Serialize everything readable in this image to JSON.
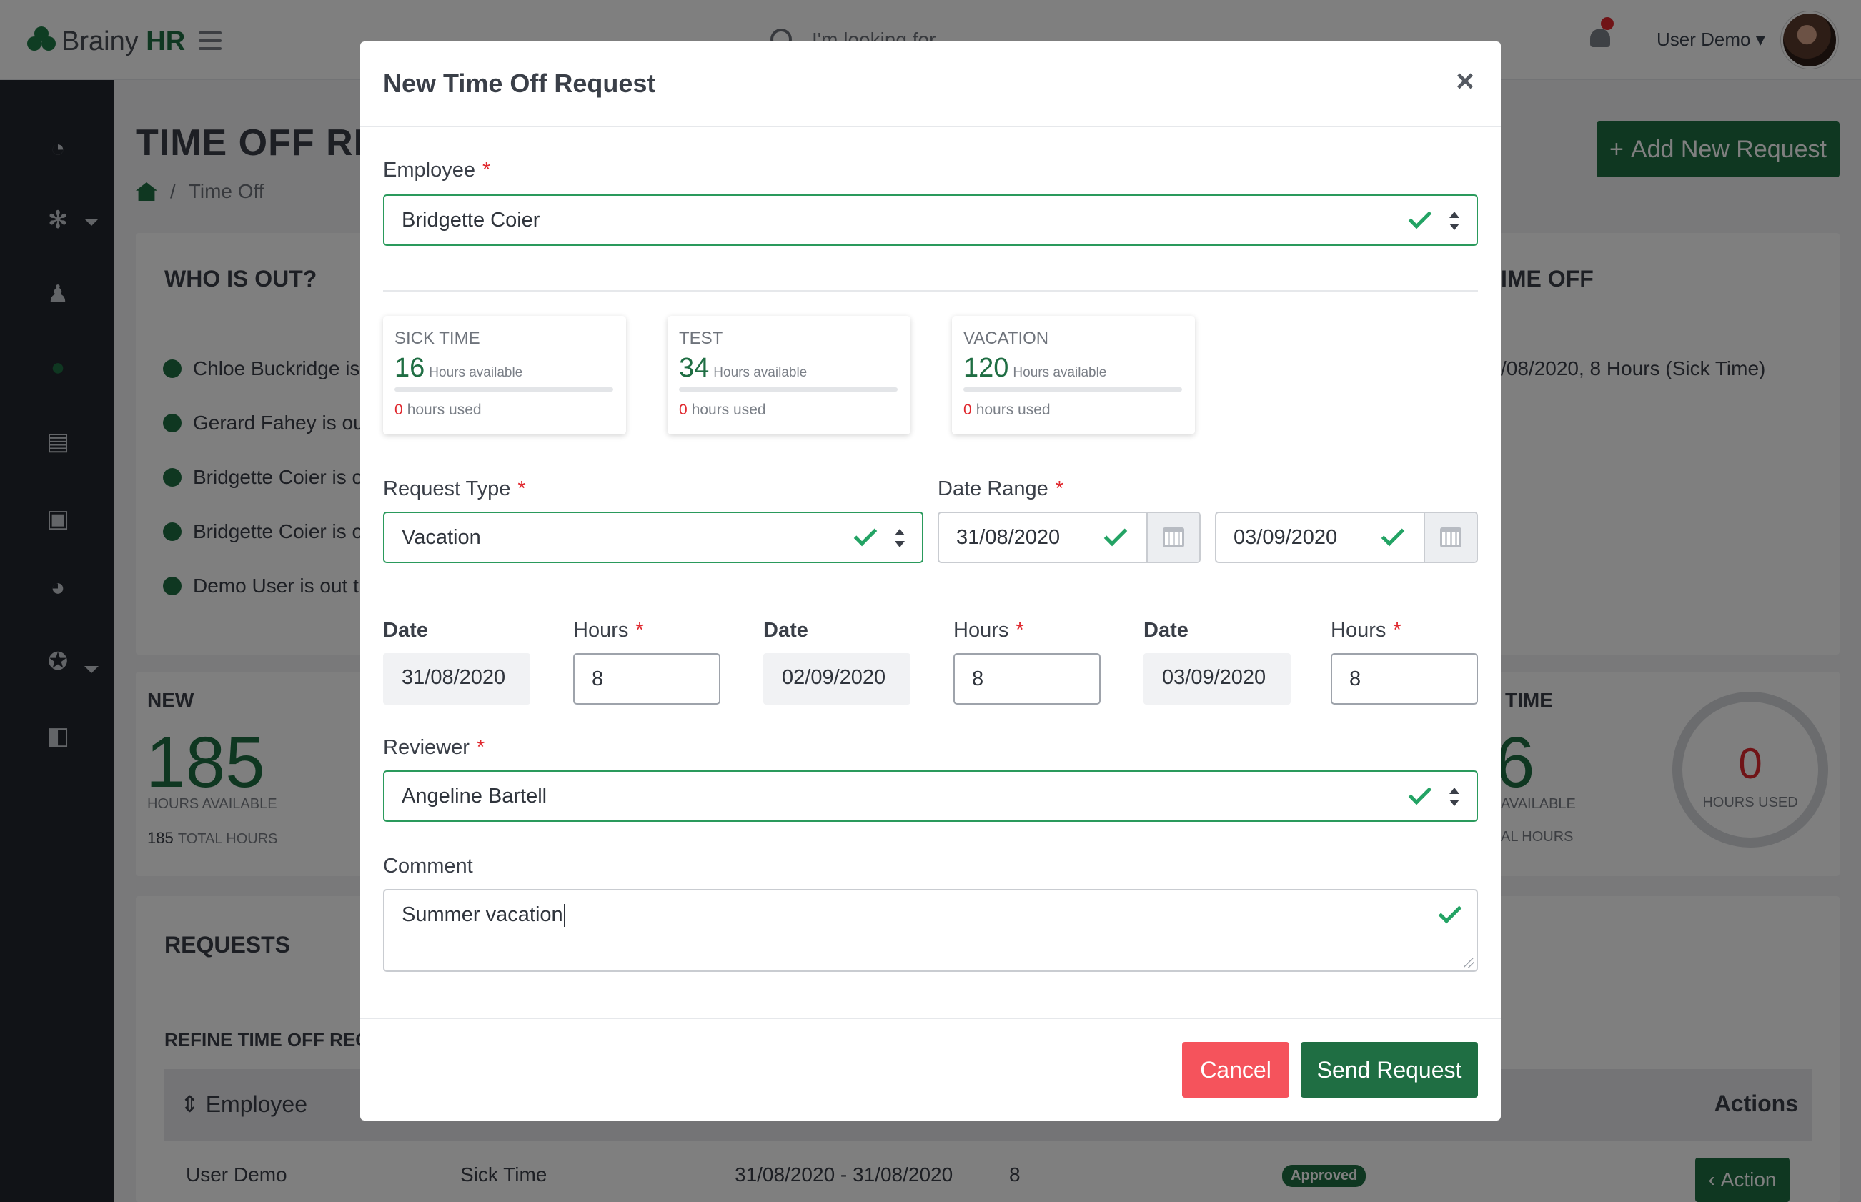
{
  "app": {
    "name_prefix": "Brainy",
    "name_suffix": "HR"
  },
  "topbar": {
    "search_placeholder": "I'm looking for...",
    "user_label": "User Demo",
    "user_caret": "▾"
  },
  "page": {
    "title": "TIME OFF REQUESTS",
    "breadcrumb_sep": "/",
    "breadcrumb_current": "Time Off",
    "add_button": "Add New Request",
    "add_icon": "+"
  },
  "who_is_out": {
    "title": "WHO IS OUT?",
    "items": [
      "Chloe Buckridge is",
      "Gerard Fahey is ou",
      "Bridgette Coier is o",
      "Bridgette Coier is o",
      "Demo User is out t"
    ]
  },
  "upcoming": {
    "title_fragment": "IME OFF",
    "item_fragment": "/08/2020, 8 Hours (Sick Time)"
  },
  "new_card": {
    "title": "NEW",
    "value": "185",
    "caption": "HOURS AVAILABLE",
    "total_value": "185",
    "total_caption": "TOTAL HOURS"
  },
  "time_card": {
    "title_fragment": "TIME",
    "value_fragment": "6",
    "caption_fragment": "AVAILABLE",
    "total_fragment": "AL HOURS",
    "ring_value": "0",
    "ring_caption": "HOURS USED"
  },
  "requests": {
    "title": "REQUESTS",
    "refine_title": "REFINE TIME OFF REQ",
    "col_employee": "Employee",
    "col_actions": "Actions",
    "sort_icon": "⇕",
    "row": {
      "employee": "User Demo",
      "type": "Sick Time",
      "range": "31/08/2020 - 31/08/2020",
      "hours": "8",
      "status": "Approved",
      "action": "Action",
      "action_icon": "‹"
    }
  },
  "modal": {
    "title": "New Time Off Request",
    "close": "×",
    "employee_label": "Employee",
    "required_mark": "*",
    "employee_value": "Bridgette Coier",
    "balances": [
      {
        "type": "SICK TIME",
        "available": "16",
        "available_label": "Hours available",
        "used": "0",
        "used_label": "hours used"
      },
      {
        "type": "TEST",
        "available": "34",
        "available_label": "Hours available",
        "used": "0",
        "used_label": "hours used"
      },
      {
        "type": "VACATION",
        "available": "120",
        "available_label": "Hours available",
        "used": "0",
        "used_label": "hours used"
      }
    ],
    "request_type_label": "Request Type",
    "request_type_value": "Vacation",
    "date_range_label": "Date Range",
    "date_from": "31/08/2020",
    "date_to": "03/09/2020",
    "days": [
      {
        "date_label": "Date",
        "date": "31/08/2020",
        "hours_label": "Hours",
        "hours": "8"
      },
      {
        "date_label": "Date",
        "date": "02/09/2020",
        "hours_label": "Hours",
        "hours": "8"
      },
      {
        "date_label": "Date",
        "date": "03/09/2020",
        "hours_label": "Hours",
        "hours": "8"
      }
    ],
    "reviewer_label": "Reviewer",
    "reviewer_value": "Angeline Bartell",
    "comment_label": "Comment",
    "comment_value": "Summer vacation",
    "cancel_button": "Cancel",
    "send_button": "Send Request"
  },
  "colors": {
    "brand": "#1f6e43",
    "valid": "#23a364",
    "danger": "#f5535c",
    "required": "#e0292f"
  }
}
